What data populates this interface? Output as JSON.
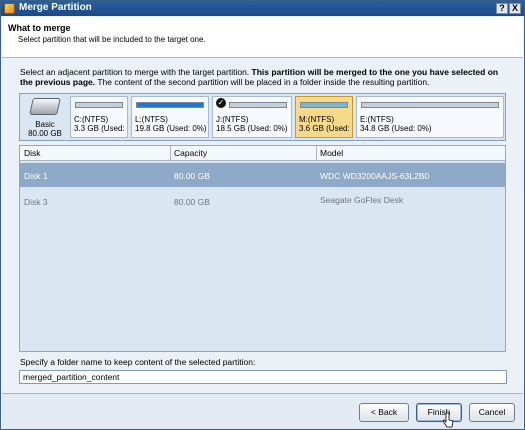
{
  "window": {
    "title": "Merge Partition",
    "help_button": "?",
    "close_button": "X"
  },
  "header": {
    "title": "What to merge",
    "subtitle": "Select partition that will be included to the target one."
  },
  "description": {
    "part1": "Select an adjacent partition to merge with the target partition. ",
    "bold": "This partition will be merged to the one you have selected on the previous page.",
    "part2": " The content of the second partition will be placed in a folder inside the resulting partition."
  },
  "disk_map": {
    "disk_label": "Basic",
    "disk_size": "80.00 GB",
    "partitions": [
      {
        "label": "C:(NTFS)",
        "sub": "3.3 GB (Used:",
        "fill": 0,
        "bar_color": "#c9cfd6",
        "checked": false,
        "selected": false
      },
      {
        "label": "L:(NTFS)",
        "sub": "19.8 GB (Used: 0%)",
        "fill": 1.0,
        "bar_color": "#1f76d6",
        "checked": false,
        "selected": false
      },
      {
        "label": "J:(NTFS)",
        "sub": "18.5 GB (Used: 0%)",
        "fill": 0,
        "bar_color": "#c9cfd6",
        "checked": true,
        "selected": false
      },
      {
        "label": "M:(NTFS)",
        "sub": "3.6 GB (Used:",
        "fill": 1.0,
        "bar_color": "#7fb6c8",
        "checked": false,
        "selected": true
      },
      {
        "label": "E:(NTFS)",
        "sub": "34.8 GB (Used: 0%)",
        "fill": 0,
        "bar_color": "#c9cfd6",
        "checked": false,
        "selected": false
      }
    ]
  },
  "table": {
    "columns": [
      "Disk",
      "Capacity",
      "Model"
    ],
    "rows": [
      {
        "disk": "Disk 1",
        "capacity": "80.00 GB",
        "model": "WDC WD3200AAJS-63L2B0",
        "selected": true
      },
      {
        "disk": "Disk 3",
        "capacity": "80.00 GB",
        "model": "Seagate GoFlex Desk",
        "selected": false
      }
    ]
  },
  "folder": {
    "label": "Specify a folder name to keep content of the selected partition:",
    "value": "merged_partition_content"
  },
  "buttons": {
    "back": "< Back",
    "finish": "Finish",
    "cancel": "Cancel"
  }
}
